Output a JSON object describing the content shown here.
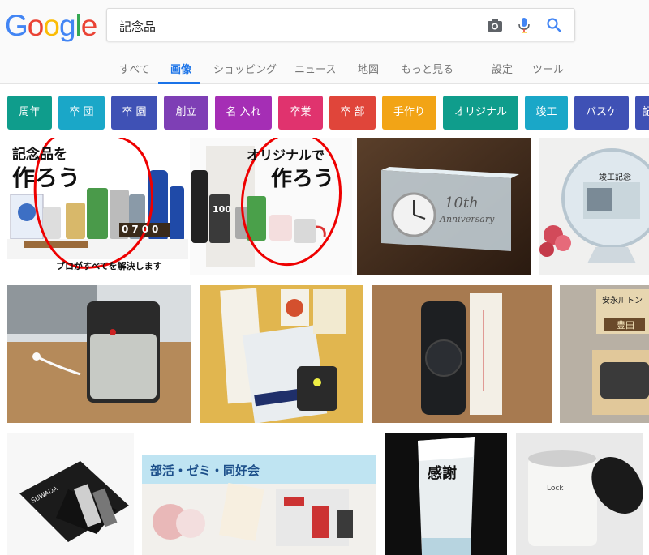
{
  "logo": {
    "letters": [
      {
        "ch": "G",
        "color": "#4285F4"
      },
      {
        "ch": "o",
        "color": "#EA4335"
      },
      {
        "ch": "o",
        "color": "#FBBC05"
      },
      {
        "ch": "g",
        "color": "#4285F4"
      },
      {
        "ch": "l",
        "color": "#34A853"
      },
      {
        "ch": "e",
        "color": "#EA4335"
      }
    ]
  },
  "search": {
    "query": "記念品",
    "camera_icon": "camera-icon",
    "mic_icon": "microphone-icon",
    "search_icon": "search-icon"
  },
  "nav": {
    "tabs": [
      {
        "label": "すべて",
        "active": false
      },
      {
        "label": "画像",
        "active": true
      },
      {
        "label": "ショッピング",
        "active": false
      },
      {
        "label": "ニュース",
        "active": false
      },
      {
        "label": "地図",
        "active": false
      },
      {
        "label": "もっと見る",
        "active": false
      },
      {
        "label": "設定",
        "active": false
      },
      {
        "label": "ツール",
        "active": false
      }
    ]
  },
  "chips": [
    {
      "label": "周年",
      "color": "#0f9d8c"
    },
    {
      "label": "卒 団",
      "color": "#1aa7c8"
    },
    {
      "label": "卒 園",
      "color": "#3f51b5"
    },
    {
      "label": "創立",
      "color": "#7e3fb5"
    },
    {
      "label": "名 入れ",
      "color": "#a52eb5"
    },
    {
      "label": "卒業",
      "color": "#e0336e"
    },
    {
      "label": "卒 部",
      "color": "#e0453a"
    },
    {
      "label": "手作り",
      "color": "#f2a416"
    },
    {
      "label": "オリジナル",
      "color": "#0f9d8c"
    },
    {
      "label": "竣工",
      "color": "#1aa7c8"
    },
    {
      "label": "バスケ",
      "color": "#3f51b5"
    },
    {
      "label": "記",
      "color": "#3f51b5"
    }
  ],
  "images": {
    "row1": {
      "a_title": "記念品を",
      "a_big": "作ろう",
      "a_sub": "プロがすべてを解決します",
      "a_counter": "0700",
      "b_title": "オリジナルで",
      "b_big": "作ろう",
      "b_tumbler": "100",
      "c_clock_text": "10th",
      "c_clock_sub": "Anniversary",
      "d_plaque_title": "竣工記念"
    },
    "row2": {
      "h_label": "安永川トン",
      "h_label2": "豊田"
    },
    "row3": {
      "i_brand": "SUWADA",
      "j_banner": "部活・ゼミ・同好会",
      "k_trophy": "感謝",
      "l_can": "Lock"
    }
  }
}
